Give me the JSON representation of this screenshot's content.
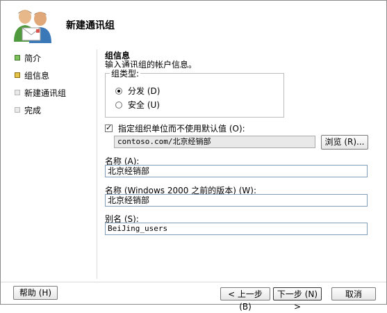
{
  "header": {
    "title": "新建通讯组",
    "icon": "users-mail-icon"
  },
  "nav": {
    "items": [
      {
        "label": "简介",
        "state": "done"
      },
      {
        "label": "组信息",
        "state": "current"
      },
      {
        "label": "新建通讯组",
        "state": "pending"
      },
      {
        "label": "完成",
        "state": "pending"
      }
    ]
  },
  "section": {
    "title": "组信息",
    "description": "输入通讯组的帐户信息。"
  },
  "group_type": {
    "legend": "组类型:",
    "options": [
      {
        "label": "分发 (D)",
        "selected": true
      },
      {
        "label": "安全 (U)",
        "selected": false
      }
    ]
  },
  "ou_checkbox": {
    "label": "指定组织单位而不使用默认值 (O):",
    "checked": true
  },
  "ou_path": {
    "value": "contoso.com/北京经销部"
  },
  "browse_button": {
    "label": "浏览 (R)..."
  },
  "fields": {
    "name_label": "名称 (A):",
    "name_value": "北京经销部",
    "pre2000_label": "名称 (Windows 2000 之前的版本) (W):",
    "pre2000_value": "北京经销部",
    "alias_label": "别名 (S):",
    "alias_value": "BeiJing_users"
  },
  "footer": {
    "help": "帮助 (H)",
    "prev": "< 上一步 (B)",
    "next": "下一步 (N) >",
    "cancel": "取消"
  }
}
